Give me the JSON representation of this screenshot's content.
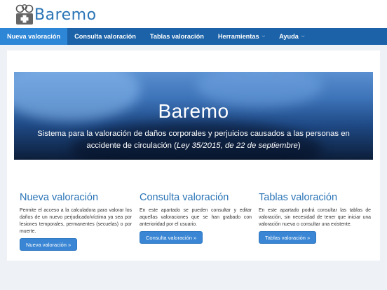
{
  "brand": {
    "name": "Baremo",
    "accent": "#2a74b6",
    "nav_bg": "#1b62a8",
    "nav_active_bg": "#2e86d6"
  },
  "nav": {
    "items": [
      {
        "label": "Nueva valoración",
        "active": true,
        "dropdown": false
      },
      {
        "label": "Consulta valoración",
        "active": false,
        "dropdown": false
      },
      {
        "label": "Tablas valoración",
        "active": false,
        "dropdown": false
      },
      {
        "label": "Herramientas",
        "active": false,
        "dropdown": true
      },
      {
        "label": "Ayuda",
        "active": false,
        "dropdown": true
      }
    ],
    "dropdown_icon": "chevron-down-icon"
  },
  "hero": {
    "title": "Baremo",
    "subtitle_main": "Sistema para la valoración de daños corporales y perjuicios causados a las personas en accidente de circulación (",
    "subtitle_law": "Ley 35/2015, de 22 de septiembre",
    "subtitle_end": ")"
  },
  "sections": [
    {
      "title": "Nueva valoración",
      "text": "Permite el acceso a la calculadora para valorar los daños de un nuevo perjudicado/víctima ya sea por lesiones temporales, permanentes (secuelas) o por muerte.",
      "button": "Nueva valoración »"
    },
    {
      "title": "Consulta valoración",
      "text": "En este apartado se pueden consultar y editar aquellas valoraciones que se han grabado con anterioridad por el usuario.",
      "button": "Consulta valoración »"
    },
    {
      "title": "Tablas valoración",
      "text": "En este apartado podrá consultar las tablas de valoración, sin necesidad de tener que iniciar una valoración nueva o consultar una existente.",
      "button": "Tablas valoración »"
    }
  ]
}
